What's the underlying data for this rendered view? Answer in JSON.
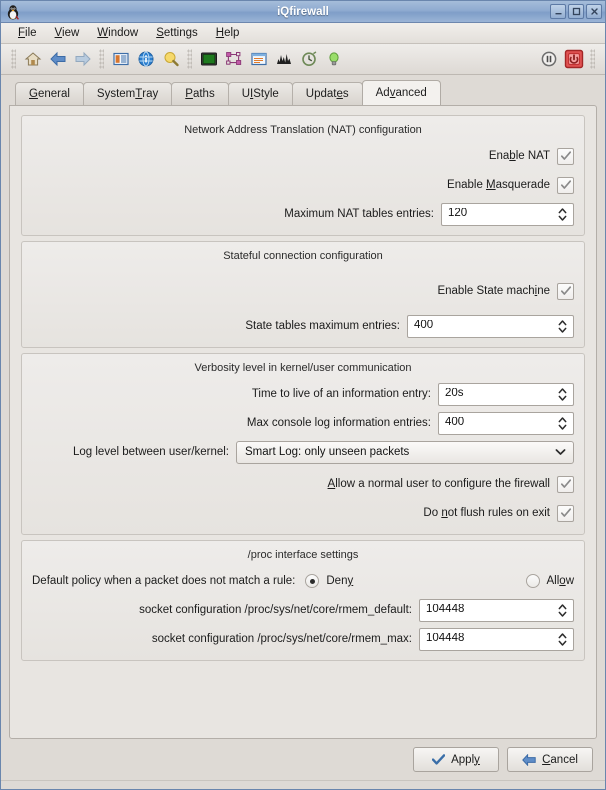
{
  "window": {
    "title": "iQfirewall",
    "app_icon": "tux-penguin-icon",
    "controls": {
      "minimize": "minimize-icon",
      "maximize": "maximize-icon",
      "close": "close-icon"
    }
  },
  "menubar": {
    "items": [
      {
        "label": "File",
        "accel": "F"
      },
      {
        "label": "View",
        "accel": "V"
      },
      {
        "label": "Window",
        "accel": "W"
      },
      {
        "label": "Settings",
        "accel": "S"
      },
      {
        "label": "Help",
        "accel": "H"
      }
    ]
  },
  "toolbar": {
    "left_items": [
      "home-icon",
      "back-arrow-icon",
      "forward-arrow-icon",
      "rules-list-icon",
      "info-globe-icon",
      "search-bulb-icon",
      "console-icon",
      "network-nodes-icon",
      "window-log-icon",
      "statistics-chart-icon",
      "clock-history-icon",
      "light-bulb-icon"
    ],
    "right_items": [
      "pause-icon",
      "power-stop-icon"
    ]
  },
  "tabs": [
    {
      "label": "General",
      "accel": "G",
      "active": false
    },
    {
      "label": "System Tray",
      "accel": "T",
      "active": false
    },
    {
      "label": "Paths",
      "accel": "P",
      "active": false
    },
    {
      "label": "UI Style",
      "accel": "I",
      "active": false
    },
    {
      "label": "Updates",
      "accel": "e",
      "active": false
    },
    {
      "label": "Advanced",
      "accel": "v",
      "active": true
    }
  ],
  "groups": {
    "nat": {
      "title": "Network Address Translation (NAT) configuration",
      "enable_nat_label": "Enable NAT",
      "enable_nat_checked": "checked",
      "enable_masquerade_label": "Enable Masquerade",
      "enable_masquerade_checked": "checked",
      "max_tables_label": "Maximum NAT tables entries:",
      "max_tables_value": "120"
    },
    "stateful": {
      "title": "Stateful connection configuration",
      "enable_state_label": "Enable State machine",
      "enable_state_checked": "checked",
      "state_max_label": "State tables maximum entries:",
      "state_max_value": "400"
    },
    "verbosity": {
      "title": "Verbosity level in kernel/user communication",
      "ttl_label": "Time to live of an information entry:",
      "ttl_value": "20s",
      "max_console_label": "Max console log information entries:",
      "max_console_value": "400",
      "log_level_label": "Log level between user/kernel:",
      "log_level_value": "Smart Log: only unseen packets",
      "allow_user_label": "Allow a normal user to configure the firewall",
      "allow_user_checked": "checked",
      "no_flush_label": "Do not flush rules on exit",
      "no_flush_checked": "checked"
    },
    "proc": {
      "title": "/proc interface settings",
      "default_policy_label": "Default policy when a packet does not match a rule:",
      "policy_deny_label": "Deny",
      "policy_allow_label": "Allow",
      "policy_selected": "Deny",
      "rmem_default_label": "socket configuration /proc/sys/net/core/rmem_default:",
      "rmem_default_value": "104448",
      "rmem_max_label": "socket configuration /proc/sys/net/core/rmem_max:",
      "rmem_max_value": "104448"
    }
  },
  "buttons": {
    "apply": "Apply",
    "cancel": "Cancel"
  },
  "colors": {
    "titlebar": "#8fabd0",
    "window_bg": "#dedad5",
    "page_bg": "#e8e5e1",
    "group_bg": "#eceae6",
    "accent_red": "#d94b4b",
    "text": "#1c1c1c"
  }
}
